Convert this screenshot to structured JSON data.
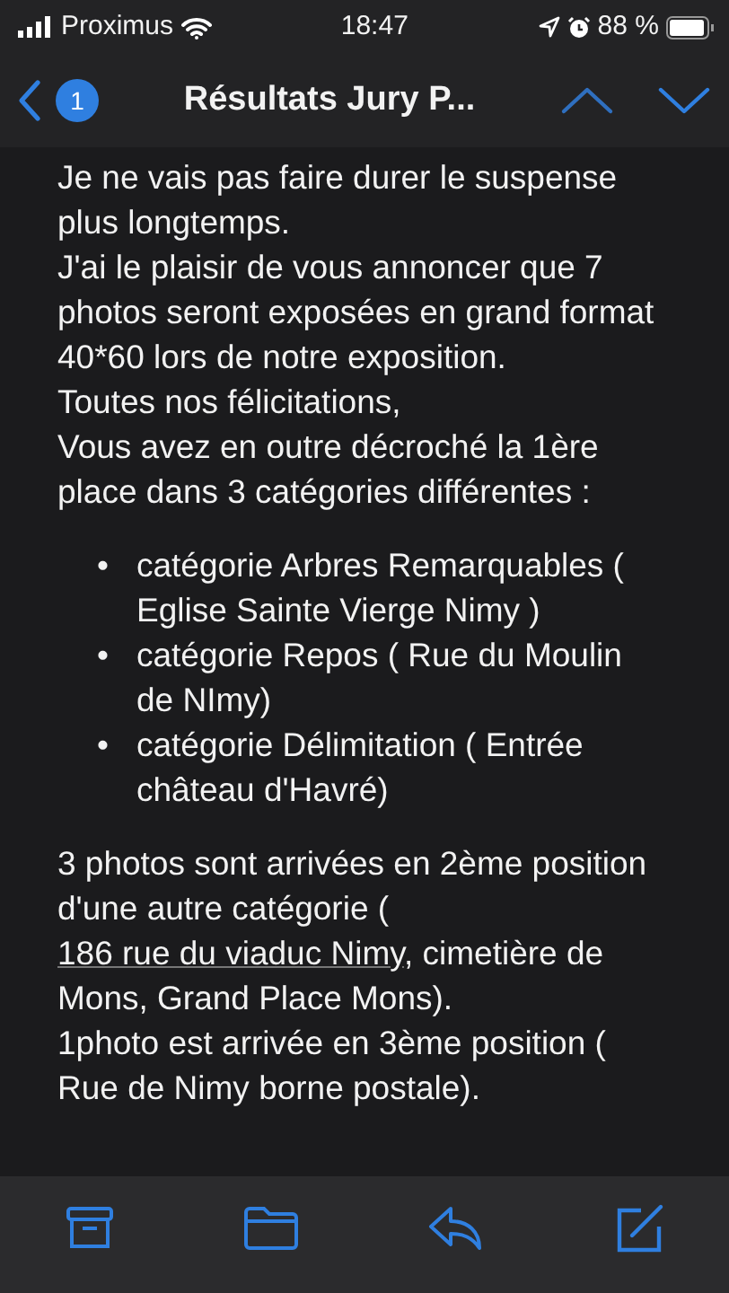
{
  "status_bar": {
    "carrier": "Proximus",
    "time": "18:47",
    "battery": "88 %"
  },
  "nav_bar": {
    "unread_count": "1",
    "title": "Résultats Jury P..."
  },
  "message": {
    "intro": [
      "Je ne vais pas faire durer le suspense plus longtemps.",
      "J'ai le plaisir de vous annoncer que 7 photos seront exposées en grand format 40*60 lors de notre exposition.",
      "Toutes nos félicitations,",
      "Vous avez en outre décroché la 1ère place dans 3 catégories différentes :"
    ],
    "bullets": [
      {
        "marker": "•",
        "text": "catégorie Arbres Remarquables ( Eglise Sainte Vierge Nimy )"
      },
      {
        "marker": "•",
        "text": "catégorie Repos ( Rue du Moulin de NImy)"
      },
      {
        "marker": "•",
        "text": "catégorie Délimitation ( Entrée château d'Havré)"
      }
    ],
    "outro": [
      {
        "before": "3 photos sont arrivées en 2ème position d'une autre catégorie (",
        "link": "186 rue du viaduc Nimy",
        "after": ", cimetière de Mons, Grand Place Mons)."
      },
      {
        "before": "1photo est arrivée en 3ème position ( Rue de Nimy borne postale)."
      }
    ]
  }
}
